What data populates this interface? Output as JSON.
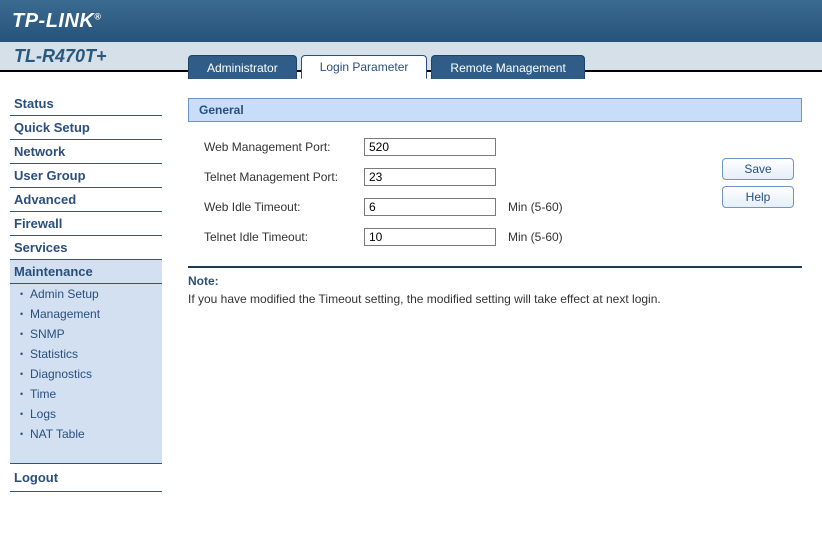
{
  "brand": "TP-LINK",
  "model": "TL-R470T+",
  "nav": {
    "items": [
      {
        "label": "Status"
      },
      {
        "label": "Quick Setup"
      },
      {
        "label": "Network"
      },
      {
        "label": "User Group"
      },
      {
        "label": "Advanced"
      },
      {
        "label": "Firewall"
      },
      {
        "label": "Services"
      },
      {
        "label": "Maintenance"
      }
    ],
    "sub": [
      {
        "label": "Admin Setup"
      },
      {
        "label": "Management"
      },
      {
        "label": "SNMP"
      },
      {
        "label": "Statistics"
      },
      {
        "label": "Diagnostics"
      },
      {
        "label": "Time"
      },
      {
        "label": "Logs"
      },
      {
        "label": "NAT Table"
      }
    ],
    "logout": "Logout"
  },
  "tabs": [
    {
      "label": "Administrator"
    },
    {
      "label": "Login Parameter"
    },
    {
      "label": "Remote Management"
    }
  ],
  "panel": {
    "title": "General",
    "rows": [
      {
        "label": "Web Management Port:",
        "value": "520",
        "hint": ""
      },
      {
        "label": "Telnet Management Port:",
        "value": "23",
        "hint": ""
      },
      {
        "label": "Web Idle Timeout:",
        "value": "6",
        "hint": "Min (5-60)"
      },
      {
        "label": "Telnet Idle Timeout:",
        "value": "10",
        "hint": "Min (5-60)"
      }
    ]
  },
  "buttons": {
    "save": "Save",
    "help": "Help"
  },
  "note": {
    "title": "Note:",
    "text": "If you have modified the Timeout setting, the modified setting will take effect at next login."
  }
}
